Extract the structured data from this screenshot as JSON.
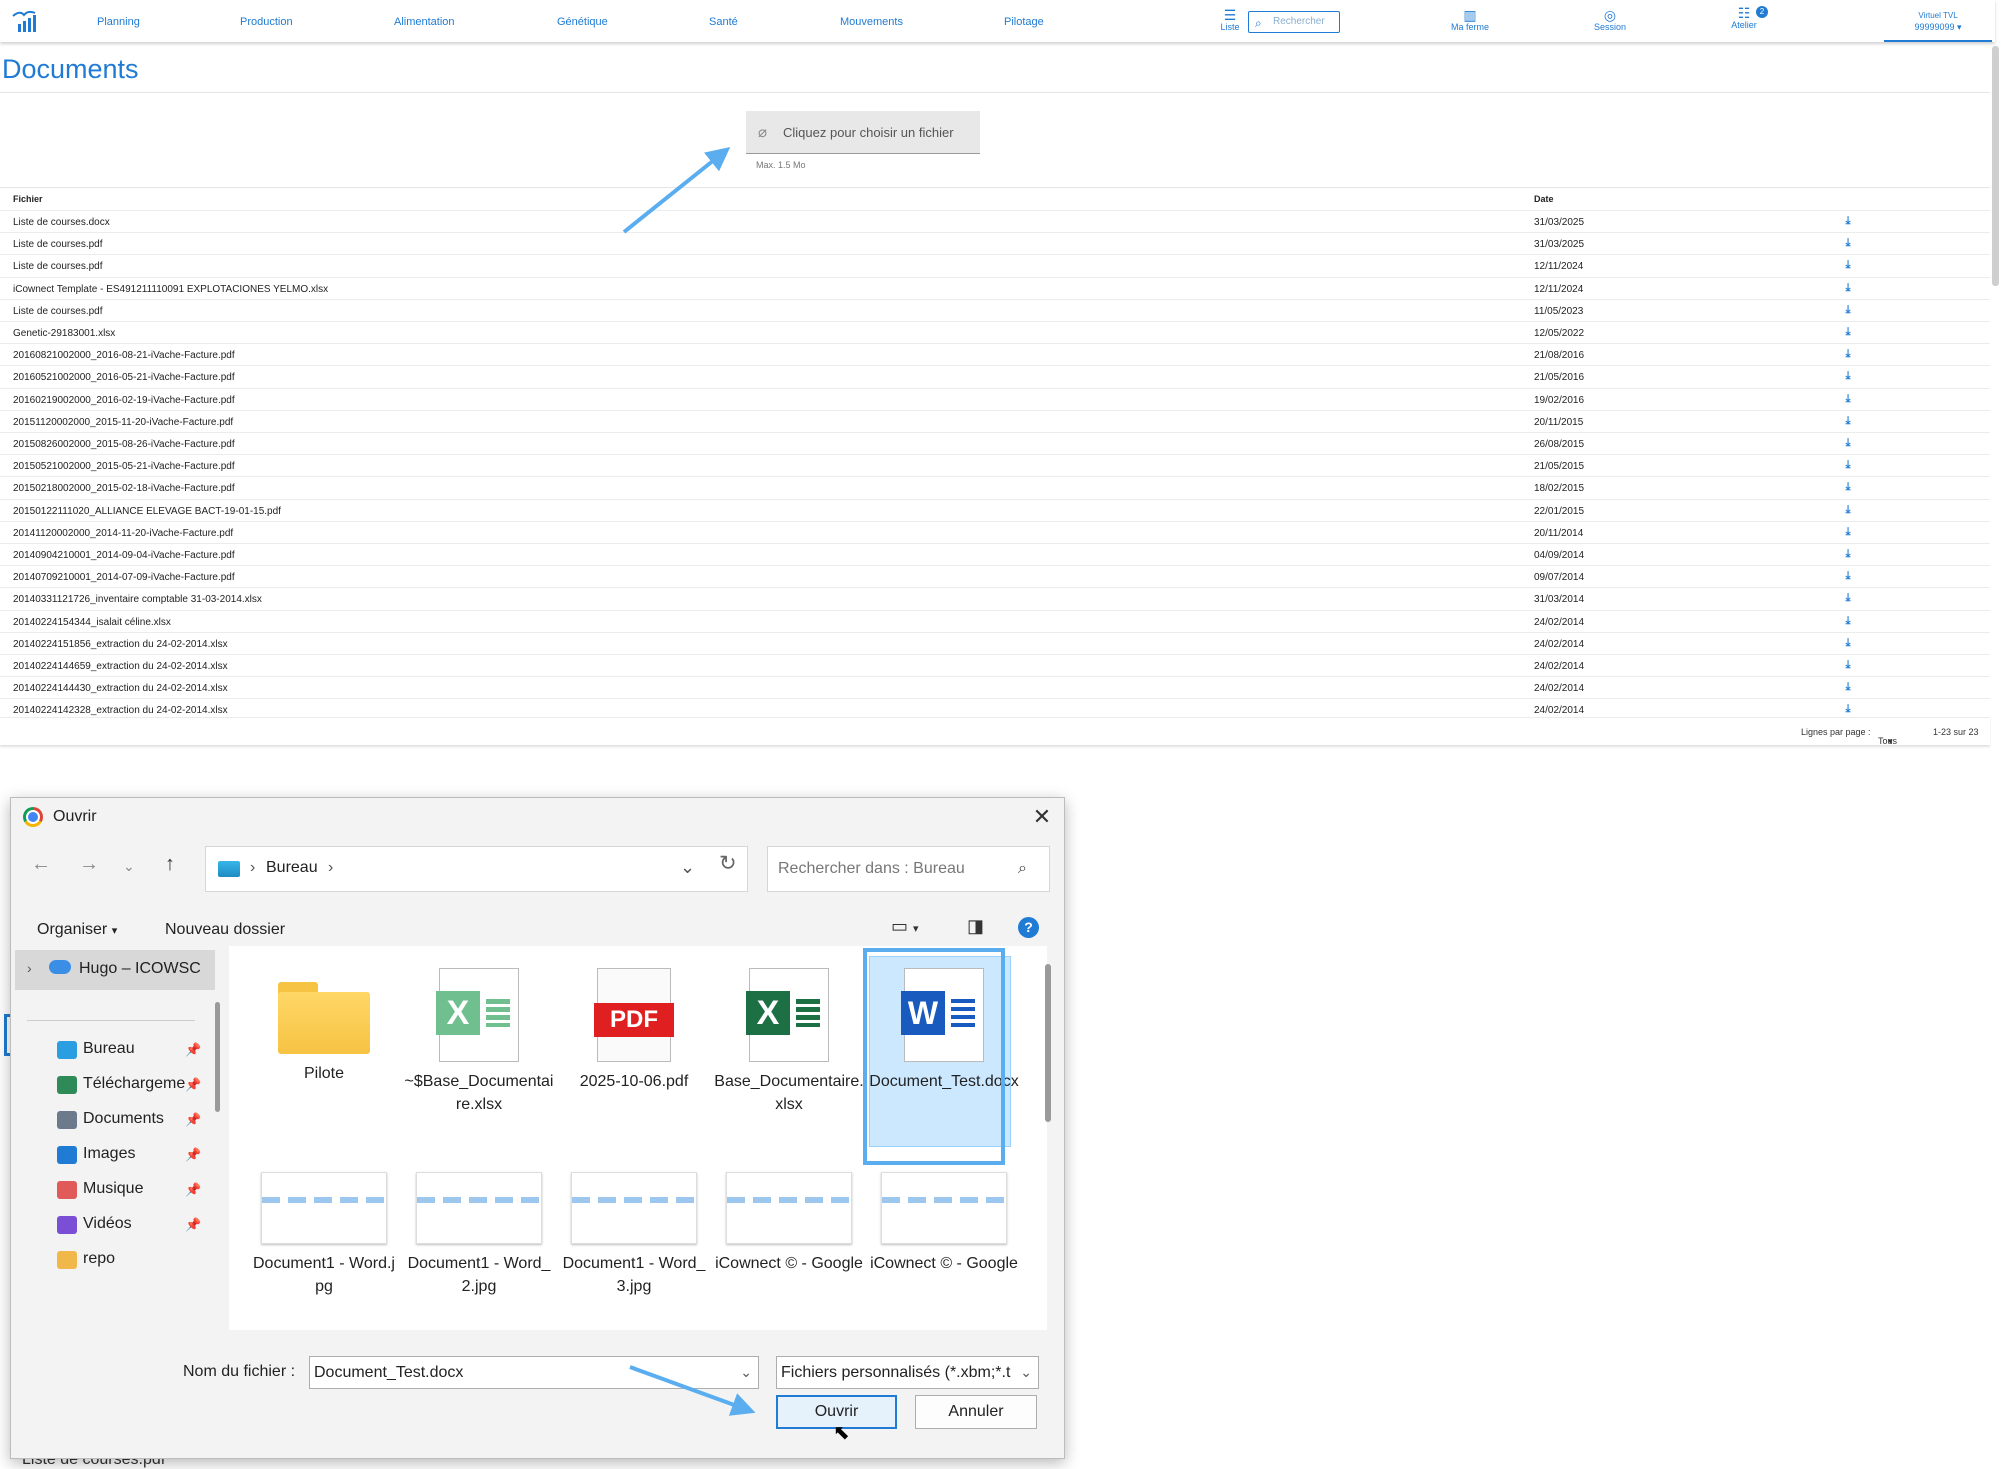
{
  "topbar": {
    "nav": [
      "Planning",
      "Production",
      "Alimentation",
      "Génétique",
      "Santé",
      "Mouvements",
      "Pilotage"
    ],
    "list_label": "Liste",
    "search_placeholder": "Rechercher",
    "my_farm": "Ma ferme",
    "session": "Session",
    "atelier": "Atelier",
    "atelier_badge": "2",
    "farm_name": "Virtuel TVL",
    "farm_id": "99999099"
  },
  "page": {
    "title": "Documents",
    "upload_label": "Cliquez pour choisir un fichier",
    "upload_hint": "Max. 1.5 Mo",
    "col_file": "Fichier",
    "col_date": "Date",
    "rows": [
      {
        "file": "Liste de courses.docx",
        "date": "31/03/2025"
      },
      {
        "file": "Liste de courses.pdf",
        "date": "31/03/2025"
      },
      {
        "file": "Liste de courses.pdf",
        "date": "12/11/2024"
      },
      {
        "file": "iCownect Template - ES491211110091 EXPLOTACIONES YELMO.xlsx",
        "date": "12/11/2024"
      },
      {
        "file": "Liste de courses.pdf",
        "date": "11/05/2023"
      },
      {
        "file": "Genetic-29183001.xlsx",
        "date": "12/05/2022"
      },
      {
        "file": "20160821002000_2016-08-21-iVache-Facture.pdf",
        "date": "21/08/2016"
      },
      {
        "file": "20160521002000_2016-05-21-iVache-Facture.pdf",
        "date": "21/05/2016"
      },
      {
        "file": "20160219002000_2016-02-19-iVache-Facture.pdf",
        "date": "19/02/2016"
      },
      {
        "file": "20151120002000_2015-11-20-iVache-Facture.pdf",
        "date": "20/11/2015"
      },
      {
        "file": "20150826002000_2015-08-26-iVache-Facture.pdf",
        "date": "26/08/2015"
      },
      {
        "file": "20150521002000_2015-05-21-iVache-Facture.pdf",
        "date": "21/05/2015"
      },
      {
        "file": "20150218002000_2015-02-18-iVache-Facture.pdf",
        "date": "18/02/2015"
      },
      {
        "file": "20150122111020_ALLIANCE ELEVAGE BACT-19-01-15.pdf",
        "date": "22/01/2015"
      },
      {
        "file": "20141120002000_2014-11-20-iVache-Facture.pdf",
        "date": "20/11/2014"
      },
      {
        "file": "20140904210001_2014-09-04-iVache-Facture.pdf",
        "date": "04/09/2014"
      },
      {
        "file": "20140709210001_2014-07-09-iVache-Facture.pdf",
        "date": "09/07/2014"
      },
      {
        "file": "20140331121726_inventaire comptable 31-03-2014.xlsx",
        "date": "31/03/2014"
      },
      {
        "file": "20140224154344_isalait céline.xlsx",
        "date": "24/02/2014"
      },
      {
        "file": "20140224151856_extraction du 24-02-2014.xlsx",
        "date": "24/02/2014"
      },
      {
        "file": "20140224144659_extraction du 24-02-2014.xlsx",
        "date": "24/02/2014"
      },
      {
        "file": "20140224144430_extraction du 24-02-2014.xlsx",
        "date": "24/02/2014"
      },
      {
        "file": "20140224142328_extraction du 24-02-2014.xlsx",
        "date": "24/02/2014"
      }
    ],
    "rows_per_page_label": "Lignes par page :",
    "rows_per_page_value": "Tous",
    "range": "1-23 sur 23"
  },
  "dialog": {
    "title": "Ouvrir",
    "path": "Bureau",
    "search_placeholder": "Rechercher dans : Bureau",
    "organize": "Organiser",
    "new_folder": "Nouveau dossier",
    "help": "?",
    "sidebar": {
      "top": "Hugo – ICOWSC",
      "items": [
        {
          "label": "Bureau",
          "icon": "desktop-icon"
        },
        {
          "label": "Téléchargeme",
          "icon": "download-icon"
        },
        {
          "label": "Documents",
          "icon": "documents-icon"
        },
        {
          "label": "Images",
          "icon": "images-icon"
        },
        {
          "label": "Musique",
          "icon": "music-icon"
        },
        {
          "label": "Vidéos",
          "icon": "videos-icon"
        },
        {
          "label": "repo",
          "icon": "folder-icon"
        }
      ]
    },
    "files": [
      {
        "label": "Pilote",
        "kind": "folder"
      },
      {
        "label": "~$Base_Documentaire.xlsx",
        "kind": "excel-temp"
      },
      {
        "label": "2025-10-06.pdf",
        "kind": "pdf"
      },
      {
        "label": "Base_Documentaire.xlsx",
        "kind": "excel"
      },
      {
        "label": "Document_Test.docx",
        "kind": "word"
      },
      {
        "label": "Document1 - Word.jpg",
        "kind": "thumb"
      },
      {
        "label": "Document1 - Word_2.jpg",
        "kind": "thumb"
      },
      {
        "label": "Document1 - Word_3.jpg",
        "kind": "thumb"
      },
      {
        "label": "iCownect © - Google",
        "kind": "thumb"
      },
      {
        "label": "iCownect © - Google",
        "kind": "thumb"
      }
    ],
    "filename_label": "Nom du fichier :",
    "filename_value": "Document_Test.docx",
    "filetype": "Fichiers personnalisés (*.xbm;*.t",
    "open": "Ouvrir",
    "cancel": "Annuler"
  },
  "behind_text": "Liste de courses.pdf",
  "colors": {
    "accent": "#1f7bd3",
    "highlight": "#5aaef0",
    "selection": "#cce8ff"
  }
}
